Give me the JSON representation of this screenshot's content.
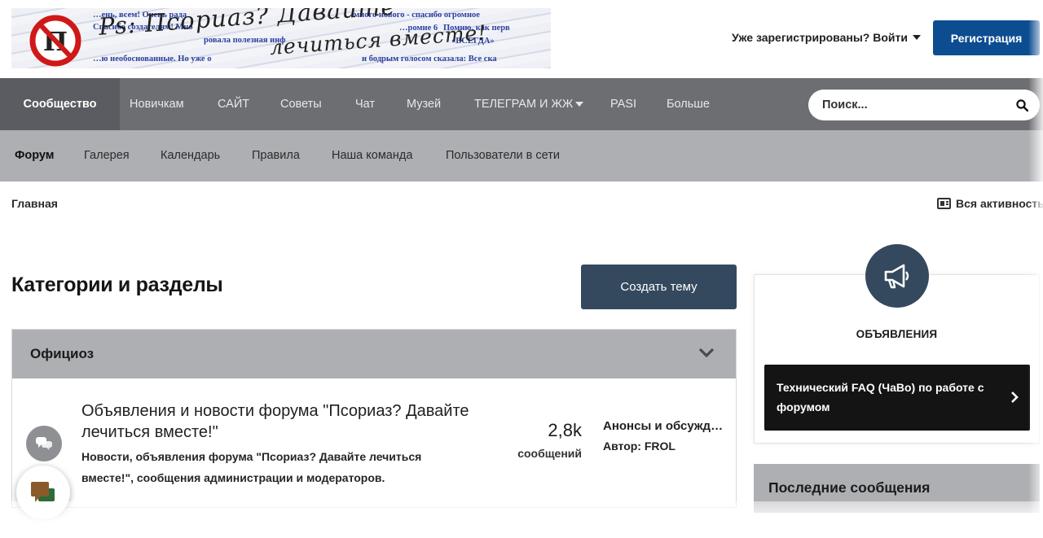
{
  "header": {
    "banner": {
      "logo_letter": "П",
      "title_line1": "Ps: Псориаз? Давайте",
      "title_line2": "лечиться вместе!",
      "news_snippets": [
        "…ень, всем! Очень рада",
        "Спасибо создателям! Мно",
        "ровала полезная инф",
        "…ю необоснованные. Но уже о",
        "много нового - спасибо огромное",
        "…ромне 6",
        "Помню, как перв",
        "«ВСЕГДА»",
        "и бодрым голосом сказала: Все ска"
      ]
    },
    "login_label": "Уже зарегистрированы? Войти",
    "register_label": "Регистрация"
  },
  "primary_nav": {
    "items": [
      {
        "label": "Сообщество",
        "active": true
      },
      {
        "label": "Новичкам"
      },
      {
        "label": "САЙТ"
      },
      {
        "label": "Советы"
      },
      {
        "label": "Чат"
      },
      {
        "label": "Музей"
      },
      {
        "label": "ТЕЛЕГРАМ И ЖЖ",
        "has_dropdown": true
      },
      {
        "label": "PASI"
      },
      {
        "label": "Больше"
      }
    ],
    "search": {
      "placeholder": "Поиск...",
      "icon": "search-icon"
    }
  },
  "secondary_nav": {
    "items": [
      {
        "label": "Форум",
        "active": true
      },
      {
        "label": "Галерея"
      },
      {
        "label": "Календарь"
      },
      {
        "label": "Правила"
      },
      {
        "label": "Наша команда"
      },
      {
        "label": "Пользователи в сети"
      }
    ]
  },
  "breadcrumb": {
    "home": "Главная",
    "all_activity": "Вся активность"
  },
  "main": {
    "title": "Категории и разделы",
    "create_button": "Создать тему",
    "category": {
      "title": "Официоз",
      "forum": {
        "title": "Объявления и новости форума \"Псориаз? Давайте лечиться вместе!\"",
        "description": "Новости, объявления форума \"Псориаз? Давайте лечиться вместе!\", сообщения администрации и модераторов.",
        "posts_count": "2,8k",
        "posts_label": "сообщений",
        "last_post_title": "Анонсы и обсужде...",
        "last_post_author": "Автор: FROL"
      }
    }
  },
  "sidebar": {
    "announcements_label": "ОБЪЯВЛЕНИЯ",
    "faq_text": "Технический FAQ (ЧаВо) по работе с форумом",
    "latest_title": "Последние сообщения"
  },
  "colors": {
    "register": "#0c4d91",
    "nav_primary": "#6d6e72",
    "nav_secondary": "#aeafb3",
    "create_button": "#34495e",
    "faq_bg": "#141414"
  }
}
